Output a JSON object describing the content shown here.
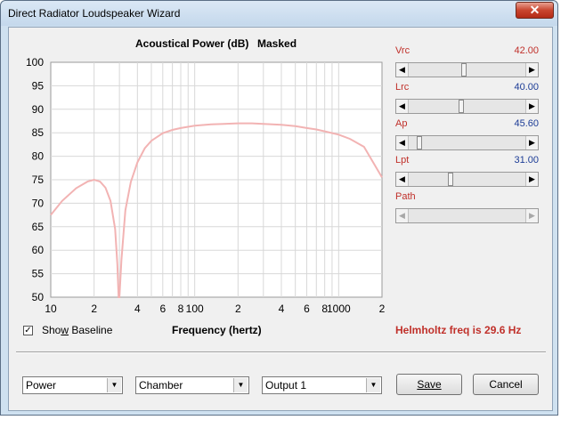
{
  "window": {
    "title": "Direct Radiator Loudspeaker Wizard",
    "close_label": "✕"
  },
  "chart_data": {
    "type": "line",
    "title": "Acoustical Power (dB)",
    "title_suffix": "Masked",
    "xlabel": "Frequency (hertz)",
    "x_scale": "log",
    "xlim": [
      10,
      2000
    ],
    "ylim": [
      50,
      100
    ],
    "grid": true,
    "y_ticks": [
      "100",
      "95",
      "90",
      "85",
      "80",
      "75",
      "70",
      "65",
      "60",
      "55",
      "50"
    ],
    "x_tick_labels": [
      "10",
      "2",
      "4",
      "6",
      "8",
      "100",
      "2",
      "4",
      "6",
      "8",
      "1000",
      "2"
    ],
    "series": [
      {
        "color": "#f2b3b3",
        "x": [
          10,
          12,
          15,
          18,
          20,
          22,
          24,
          26,
          28,
          29,
          29.6,
          30,
          31,
          33,
          36,
          40,
          45,
          50,
          60,
          70,
          80,
          100,
          130,
          160,
          200,
          250,
          300,
          400,
          500,
          600,
          700,
          800,
          1000,
          1200,
          1500,
          2000
        ],
        "y": [
          67.5,
          70.5,
          73.2,
          74.6,
          75.0,
          74.6,
          73.3,
          70.5,
          64.5,
          57.0,
          50.0,
          50.0,
          58.0,
          68.5,
          74.5,
          78.7,
          81.7,
          83.3,
          84.9,
          85.6,
          86.0,
          86.5,
          86.8,
          86.9,
          87.0,
          87.0,
          86.9,
          86.7,
          86.4,
          86.0,
          85.7,
          85.3,
          84.6,
          83.7,
          82.0,
          75.5
        ]
      }
    ]
  },
  "show_baseline": {
    "label": "Show Baseline",
    "checked": true,
    "mark": "✓"
  },
  "helmholtz_text": "Helmholtz freq is 29.6 Hz",
  "params": [
    {
      "name": "Vrc",
      "value": "42.00",
      "position": 0.47,
      "value_color": "#c0302a"
    },
    {
      "name": "Lrc",
      "value": "40.00",
      "position": 0.45,
      "value_color": "#1c3c96"
    },
    {
      "name": "Ap",
      "value": "45.60",
      "position": 0.07,
      "value_color": "#1c3c96"
    },
    {
      "name": "Lpt",
      "value": "31.00",
      "position": 0.35,
      "value_color": "#1c3c96"
    },
    {
      "name": "Path",
      "value": "",
      "position": null,
      "value_color": "#c0302a"
    }
  ],
  "slider_arrows": {
    "left": "◀",
    "right": "▶"
  },
  "combos": [
    {
      "value": "Power",
      "arrow": "▼"
    },
    {
      "value": "Chamber",
      "arrow": "▼"
    },
    {
      "value": "Output 1",
      "arrow": "▼"
    }
  ],
  "buttons": {
    "save": "Save",
    "cancel": "Cancel"
  }
}
